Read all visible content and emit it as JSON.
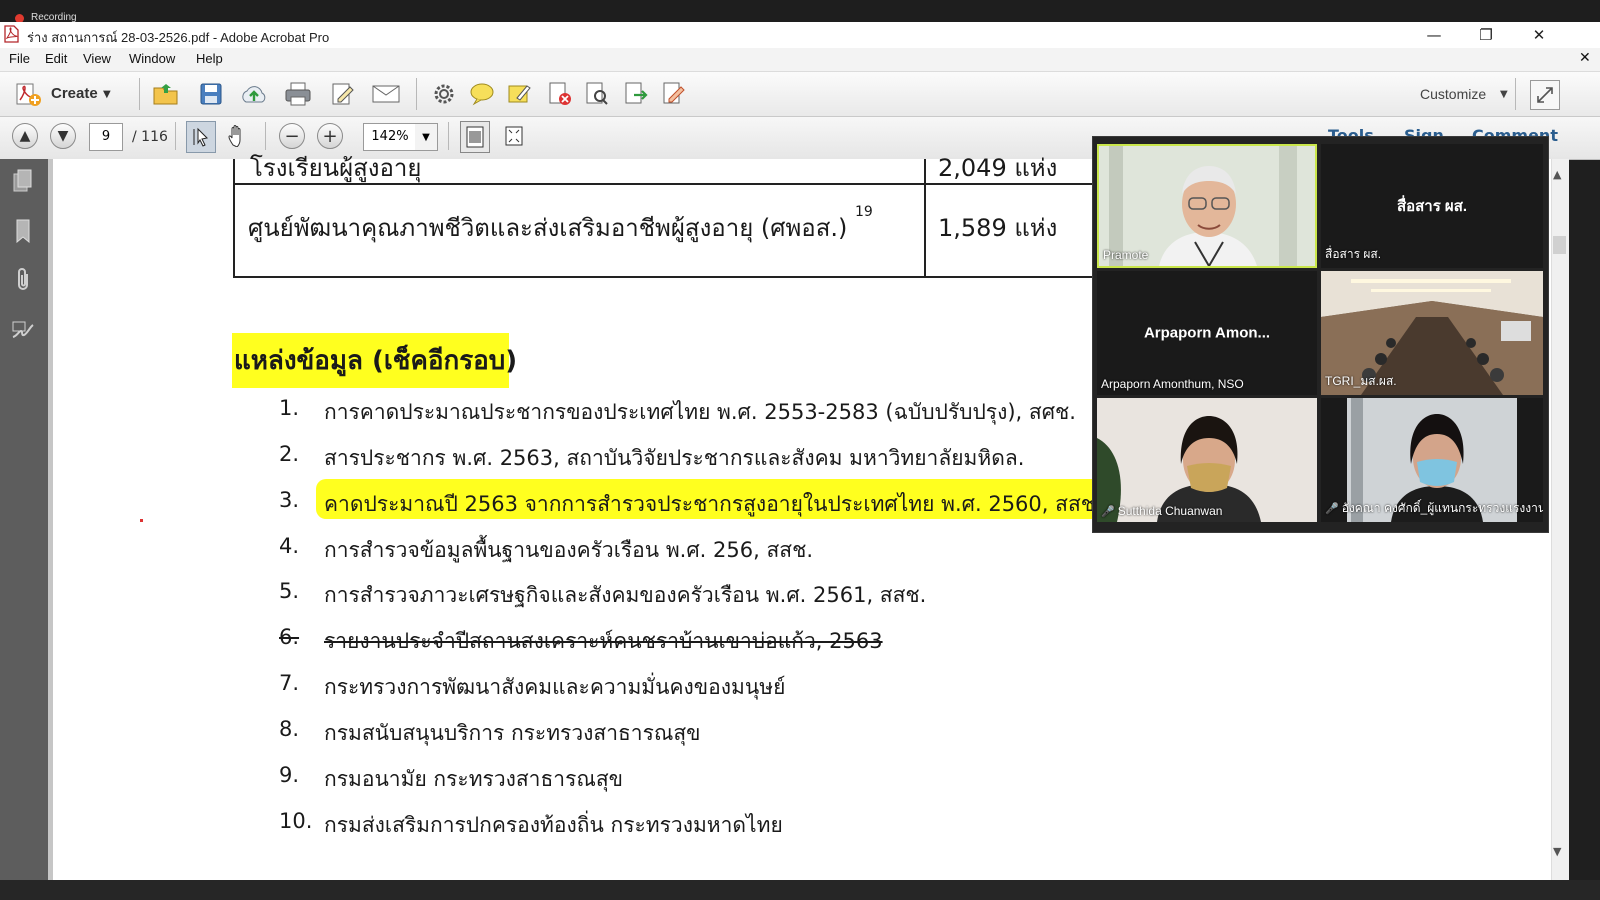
{
  "recording": {
    "label": "Recording"
  },
  "window": {
    "title": "ร่าง สถานการณ์ 28-03-2526.pdf - Adobe Acrobat Pro",
    "minimize": "—",
    "restore": "❐",
    "close": "✕"
  },
  "menu": {
    "items": [
      "File",
      "Edit",
      "View",
      "Window",
      "Help"
    ],
    "close_doc": "✕"
  },
  "toolbar": {
    "create_label": "Create",
    "customize_label": "Customize",
    "icons": [
      "open-folder-icon",
      "save-icon",
      "cloud-upload-icon",
      "print-icon",
      "edit-icon",
      "email-icon",
      "gear-icon",
      "comment-icon",
      "highlight-icon",
      "delete-pdf-icon",
      "find-icon",
      "export-icon",
      "sign-icon"
    ]
  },
  "nav": {
    "page_current": "9",
    "page_total": "/ 116",
    "zoom": "142%",
    "panel_tabs": [
      "Tools",
      "Sign",
      "Comment"
    ]
  },
  "document": {
    "table_rows": [
      {
        "name": "โรงเรียนผู้สูงอายุ",
        "value": "2,049 แห่ง"
      },
      {
        "name": "ศูนย์พัฒนาคุณภาพชีวิตและส่งเสริมอาชีพผู้สูงอายุ (ศพอส.)",
        "sup": "19",
        "value": "1,589 แห่ง"
      }
    ],
    "heading": "แหล่งข้อมูล (เช็คอีกรอบ)",
    "sources": [
      {
        "num": "1.",
        "text": "การคาดประมาณประชากรของประเทศไทย พ.ศ. 2553-2583 (ฉบับปรับปรุง), สศช."
      },
      {
        "num": "2.",
        "text": "สารประชากร  พ.ศ. 2563, สถาบันวิจัยประชากรและสังคม มหาวิทยาลัยมหิดล."
      },
      {
        "num": "3.",
        "text": "คาดประมาณปี 2563 จากการสำรวจประชากรสูงอายุในประเทศไทย พ.ศ. 2560, สสช."
      },
      {
        "num": "4.",
        "text": "การสำรวจข้อมูลพื้นฐานของครัวเรือน พ.ศ. 256, สสช."
      },
      {
        "num": "5.",
        "text": "การสำรวจภาวะเศรษฐกิจและสังคมของครัวเรือน พ.ศ. 2561, สสช."
      },
      {
        "num": "6.",
        "text": "รายงานประจำปีสถานสงเคราะห์คนชราบ้านเขาบ่อแก้ว, 2563"
      },
      {
        "num": "7.",
        "text": "กระทรวงการพัฒนาสังคมและความมั่นคงของมนุษย์"
      },
      {
        "num": "8.",
        "text": "กรมสนับสนุนบริการ กระทรวงสาธารณสุข"
      },
      {
        "num": "9.",
        "text": "กรมอนามัย กระทรวงสาธารณสุข"
      },
      {
        "num": "10.",
        "text": "กรมส่งเสริมการปกครองท้องถิ่น กระทรวงมหาดไทย"
      }
    ]
  },
  "video_call": {
    "participants": [
      {
        "name": "Pramote",
        "center": ""
      },
      {
        "name": "สื่อสาร ผส.",
        "center": "สื่อสาร ผส."
      },
      {
        "name": "Arpaporn Amonthum, NSO",
        "center": "Arpaporn  Amon..."
      },
      {
        "name": "TGRI_มส.ผส.",
        "center": ""
      },
      {
        "name": "Sutthida Chuanwan",
        "center": ""
      },
      {
        "name": "อังคณา คงศักดิ์_ผู้แทนกระทรวงแรงงาน",
        "center": ""
      }
    ]
  },
  "colors": {
    "highlight": "#ffff1f",
    "nav_panel": "#5d5d5d",
    "active_speaker": "#c9e64a"
  }
}
